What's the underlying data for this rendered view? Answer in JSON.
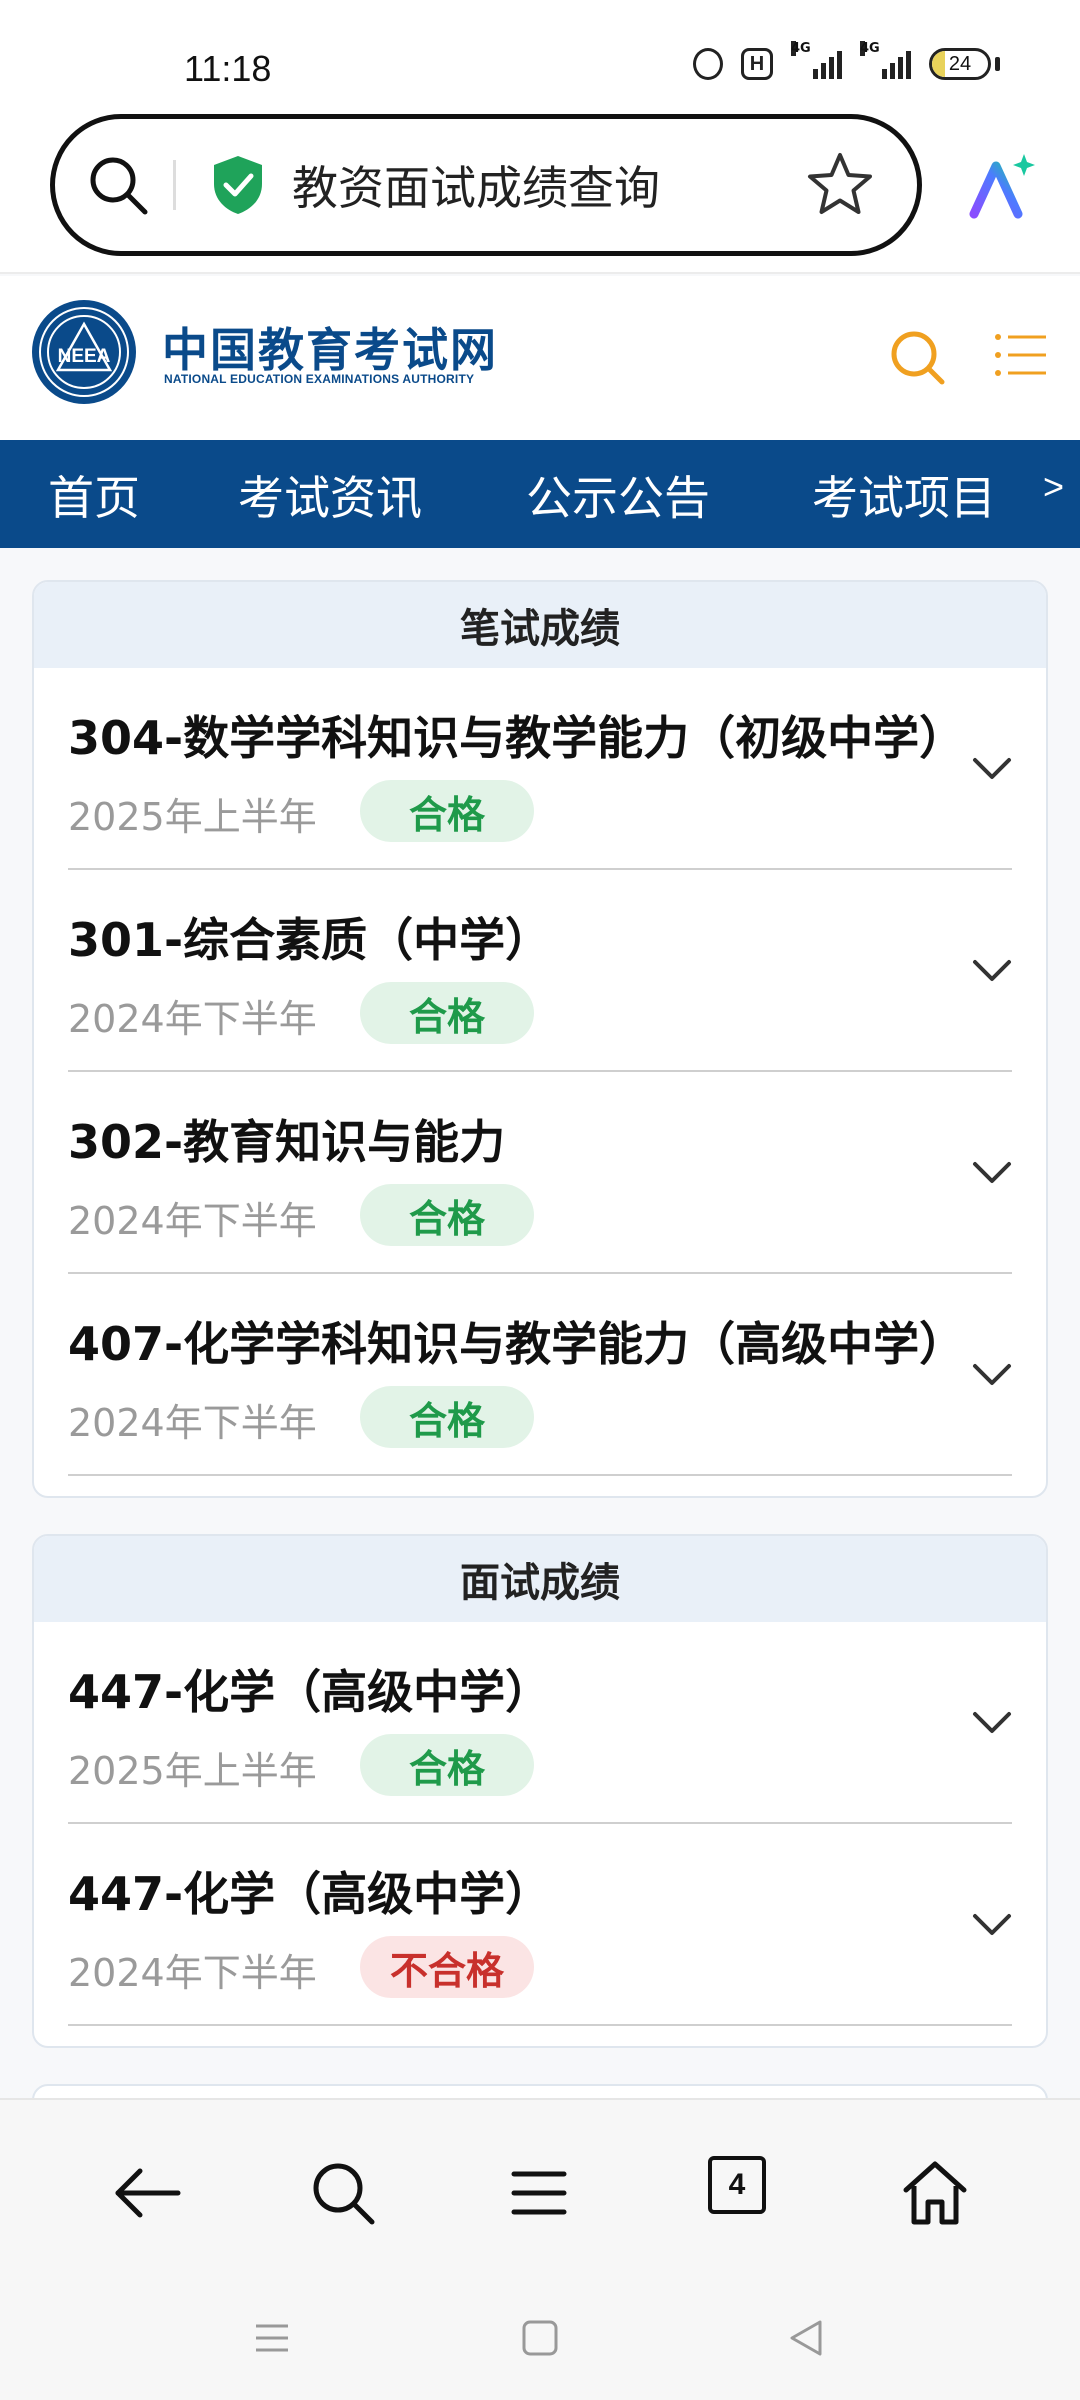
{
  "status": {
    "time": "11:18",
    "icons": [
      "alarm-timer-icon",
      "hd-icon",
      "signal-4g-icon",
      "signal-4g-icon"
    ],
    "hd_label": "H",
    "network_label": "4G",
    "battery_level": "24",
    "battery_fraction": 0.24
  },
  "browser": {
    "address_text": "教资面试成绩查询",
    "secure_color": "#1fa35a"
  },
  "site": {
    "name_cn": "中国教育考试网",
    "name_en": "NATIONAL EDUCATION EXAMINATIONS AUTHORITY",
    "emblem_text": "NEEA",
    "brand_color": "#0a4a8a",
    "accent_color": "#f0a020"
  },
  "nav": {
    "items": [
      "首页",
      "考试资讯",
      "公示公告",
      "考试项目"
    ],
    "more": ">"
  },
  "written": {
    "title": "笔试成绩",
    "rows": [
      {
        "subject": "304-数学学科知识与教学能力（初级中学）",
        "term": "2025年上半年",
        "result": "合格"
      },
      {
        "subject": "301-综合素质（中学）",
        "term": "2024年下半年",
        "result": "合格"
      },
      {
        "subject": "302-教育知识与能力",
        "term": "2024年下半年",
        "result": "合格"
      },
      {
        "subject": "407-化学学科知识与教学能力（高级中学）",
        "term": "2024年下半年",
        "result": "合格"
      }
    ]
  },
  "interview": {
    "title": "面试成绩",
    "rows": [
      {
        "subject": "447-化学（高级中学）",
        "term": "2025年上半年",
        "result": "合格"
      },
      {
        "subject": "447-化学（高级中学）",
        "term": "2024年下半年",
        "result": "不合格"
      }
    ]
  },
  "toolbar": {
    "tab_count": "4",
    "icons": [
      "back-arrow-icon",
      "search-icon",
      "menu-icon",
      "tabs-icon",
      "home-icon"
    ]
  },
  "colors": {
    "pass_text": "#1f9a4a",
    "pass_bg": "#e2f3e7",
    "fail_text": "#c8302c",
    "fail_bg": "#fbe4e4"
  }
}
